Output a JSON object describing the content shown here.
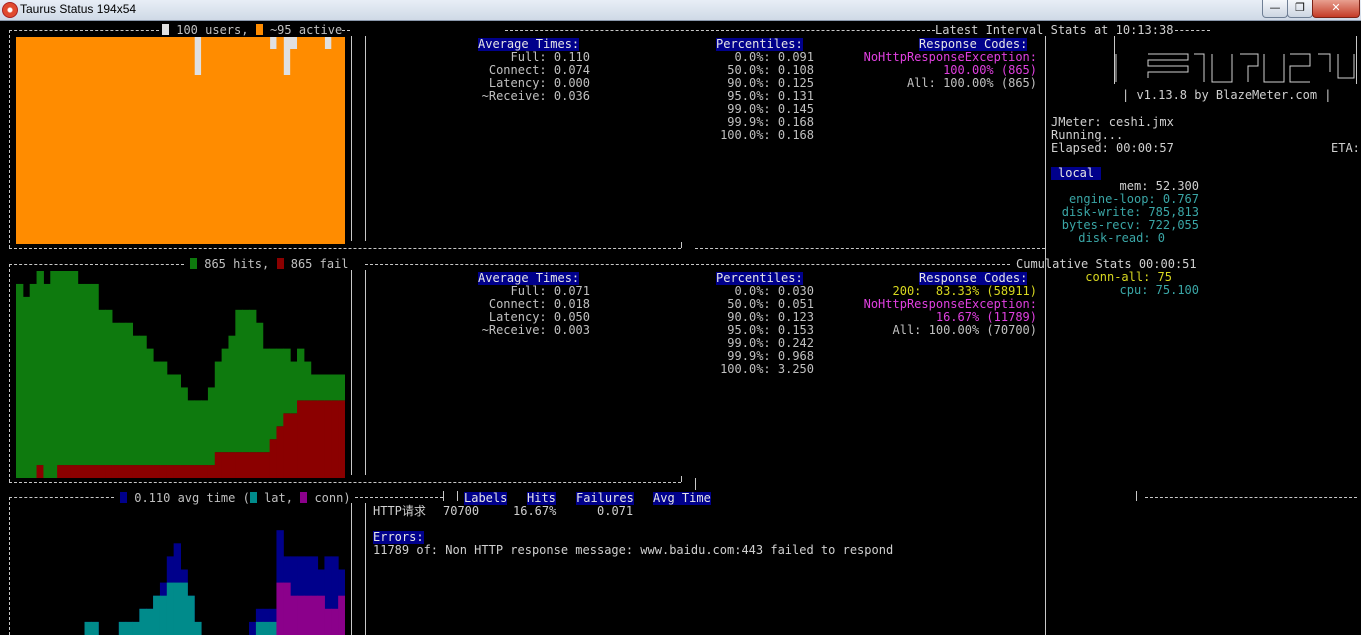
{
  "window": {
    "title": "Taurus Status 194x54",
    "controls": {
      "minimize": "—",
      "maximize": "❐",
      "close": "✕"
    }
  },
  "interval": {
    "legend_users": "100 users,",
    "legend_active": "~95 active",
    "title": "Latest Interval Stats at 10:13:38",
    "avg_times": {
      "header": "Average Times:",
      "full": "Full: 0.110",
      "connect": "Connect: 0.074",
      "latency": "Latency: 0.000",
      "receive": "~Receive: 0.036"
    },
    "percentiles": {
      "header": "Percentiles:",
      "rows": [
        "0.0%: 0.091",
        "50.0%: 0.108",
        "90.0%: 0.125",
        "95.0%: 0.131",
        "99.0%: 0.145",
        "99.9%: 0.168",
        "100.0%: 0.168"
      ]
    },
    "response_codes": {
      "header": "Response Codes:",
      "rows": [
        "NoHttpResponseException:",
        "100.00% (865)",
        "All: 100.00% (865)"
      ]
    }
  },
  "cumulative": {
    "legend_hits": "865 hits,",
    "legend_fail": "865 fail",
    "title": "Cumulative Stats 00:00:51",
    "avg_times": {
      "header": "Average Times:",
      "full": "Full: 0.071",
      "connect": "Connect: 0.018",
      "latency": "Latency: 0.050",
      "receive": "~Receive: 0.003"
    },
    "percentiles": {
      "header": "Percentiles:",
      "rows": [
        "0.0%: 0.030",
        "50.0%: 0.051",
        "90.0%: 0.123",
        "95.0%: 0.153",
        "99.0%: 0.242",
        "99.9%: 0.968",
        "100.0%: 3.250"
      ]
    },
    "response_codes": {
      "header": "Response Codes:",
      "rows": [
        "200:  83.33% (58911)",
        "NoHttpResponseException:",
        "16.67% (11789)",
        "All: 100.00% (70700)"
      ]
    }
  },
  "timing": {
    "legend_avg": "0.110 avg time (",
    "legend_lat": "lat,",
    "legend_conn": "conn)"
  },
  "labels_table": {
    "headers": [
      "Labels",
      "Hits",
      "Failures",
      "Avg Time"
    ],
    "row": {
      "label": "HTTP请求",
      "hits": "70700",
      "failures": "16.67%",
      "avg_time": "0.071"
    }
  },
  "errors": {
    "header": "Errors:",
    "message": "11789 of: Non HTTP response message: www.baidu.com:443 failed to respond"
  },
  "sidebar": {
    "version": "| v1.13.8 by BlazeMeter.com |",
    "jmeter": "JMeter: ceshi.jmx",
    "running": "Running...",
    "elapsed": "Elapsed: 00:00:57",
    "eta": "ETA:",
    "local_header": "local",
    "mem": "mem: 52.300",
    "engine_loop": "engine-loop: 0.767",
    "disk_write": "disk-write: 785,813",
    "bytes_recv": "bytes-recv: 722,055",
    "disk_read": "disk-read: 0",
    "conn_all": "conn-all: 75",
    "cpu": "cpu: 75.100"
  },
  "chart_data": [
    {
      "type": "area",
      "title": "",
      "series": [
        {
          "name": "100 users",
          "values": [
            100,
            100,
            100,
            100,
            100,
            100,
            100,
            100,
            100,
            100,
            100,
            100,
            100,
            100,
            100,
            100,
            100,
            100,
            100,
            100,
            100,
            100,
            100,
            100,
            100,
            100,
            100,
            100,
            100,
            100,
            100,
            100,
            100,
            100,
            100,
            100,
            100,
            100,
            100,
            100,
            100,
            100,
            100,
            100,
            100,
            100,
            100,
            100
          ]
        },
        {
          "name": "~95 active",
          "values": [
            100,
            100,
            100,
            100,
            100,
            100,
            100,
            100,
            100,
            100,
            100,
            100,
            100,
            100,
            100,
            100,
            100,
            100,
            100,
            100,
            100,
            100,
            100,
            100,
            100,
            100,
            100,
            100,
            100,
            100,
            100,
            100,
            100,
            100,
            100,
            100,
            100,
            100,
            100,
            100,
            100,
            100,
            100,
            100,
            100,
            100,
            100,
            100
          ]
        }
      ]
    },
    {
      "type": "bar",
      "title": "",
      "series": [
        {
          "name": "865 hits",
          "values": [
            15,
            14,
            15,
            15,
            15,
            16,
            16,
            15,
            15,
            14,
            14,
            14,
            12,
            12,
            11,
            11,
            11,
            10,
            10,
            9,
            8,
            8,
            7,
            7,
            6,
            5,
            5,
            5,
            6,
            7,
            8,
            9,
            11,
            11,
            11,
            10,
            8,
            7,
            6,
            5,
            4,
            4,
            3,
            2,
            2,
            2,
            2,
            2
          ]
        },
        {
          "name": "865 fail",
          "values": [
            0,
            0,
            0,
            1,
            0,
            0,
            1,
            1,
            1,
            1,
            1,
            1,
            1,
            1,
            1,
            1,
            1,
            1,
            1,
            1,
            1,
            1,
            1,
            1,
            1,
            1,
            1,
            1,
            1,
            2,
            2,
            2,
            2,
            2,
            2,
            2,
            2,
            3,
            4,
            5,
            5,
            6,
            6,
            6,
            6,
            6,
            6,
            6
          ]
        }
      ]
    },
    {
      "type": "bar",
      "title": "",
      "series": [
        {
          "name": "lat",
          "values": [
            0,
            0,
            0,
            0,
            0,
            0,
            0,
            0,
            0,
            0,
            1,
            1,
            0,
            0,
            0,
            1,
            1,
            1,
            2,
            2,
            3,
            3,
            4,
            4,
            4,
            3,
            1,
            0,
            0,
            0,
            0,
            0,
            0,
            0,
            0,
            1,
            1,
            1,
            1,
            2,
            2,
            2,
            2,
            2,
            1,
            1,
            1,
            1
          ]
        },
        {
          "name": "conn",
          "values": [
            0,
            0,
            0,
            0,
            0,
            0,
            0,
            0,
            0,
            0,
            0,
            0,
            0,
            0,
            0,
            0,
            0,
            0,
            0,
            0,
            0,
            0,
            0,
            0,
            0,
            0,
            0,
            0,
            0,
            0,
            0,
            0,
            0,
            0,
            0,
            0,
            0,
            0,
            4,
            4,
            3,
            3,
            3,
            3,
            3,
            2,
            2,
            3
          ]
        },
        {
          "name": "avg time",
          "values": [
            0,
            0,
            0,
            0,
            0,
            0,
            0,
            0,
            0,
            0,
            1,
            1,
            0,
            0,
            0,
            1,
            1,
            1,
            2,
            2,
            3,
            4,
            6,
            7,
            5,
            3,
            1,
            0,
            0,
            0,
            0,
            0,
            0,
            0,
            1,
            2,
            2,
            2,
            8,
            6,
            6,
            6,
            6,
            6,
            5,
            6,
            6,
            5
          ]
        }
      ]
    }
  ]
}
